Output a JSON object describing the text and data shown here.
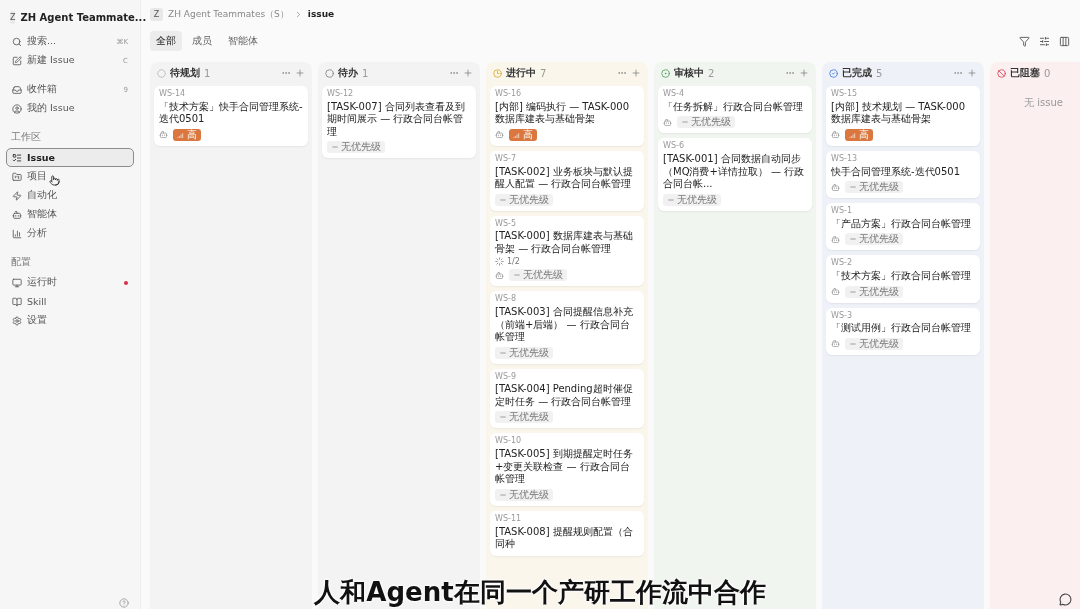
{
  "sidebar": {
    "workspace": {
      "initial": "Z",
      "name": "ZH Agent Teammate..."
    },
    "actions": [
      {
        "kind": "search",
        "label": "搜索...",
        "shortcut": "⌘K"
      },
      {
        "kind": "new",
        "label": "新建 Issue",
        "shortcut": "C"
      }
    ],
    "personal": [
      {
        "kind": "inbox",
        "label": "收件箱",
        "count": "9",
        "selected": false,
        "alert": false
      },
      {
        "kind": "mine",
        "label": "我的 Issue",
        "selected": false,
        "alert": false
      }
    ],
    "sections": [
      {
        "title": "工作区",
        "items": [
          {
            "kind": "issue",
            "label": "Issue",
            "selected": true,
            "alert": false
          },
          {
            "kind": "project",
            "label": "项目",
            "selected": false,
            "alert": false
          },
          {
            "kind": "automation",
            "label": "自动化",
            "selected": false,
            "alert": false
          },
          {
            "kind": "agent",
            "label": "智能体",
            "selected": false,
            "alert": false
          },
          {
            "kind": "analytics",
            "label": "分析",
            "selected": false,
            "alert": false
          }
        ]
      },
      {
        "title": "配置",
        "items": [
          {
            "kind": "runtime",
            "label": "运行时",
            "selected": false,
            "alert": true
          },
          {
            "kind": "skill",
            "label": "Skill",
            "selected": false,
            "alert": false
          },
          {
            "kind": "settings",
            "label": "设置",
            "selected": false,
            "alert": false
          }
        ]
      }
    ]
  },
  "breadcrumb": {
    "initial": "Z",
    "workspace": "ZH Agent Teammates（S）",
    "page": "issue"
  },
  "tabs": [
    {
      "label": "全部",
      "selected": true
    },
    {
      "label": "成员",
      "selected": false
    },
    {
      "label": "智能体",
      "selected": false
    }
  ],
  "columns": [
    {
      "kind": "planned",
      "title": "待规划",
      "count": "1",
      "cards": [
        {
          "id": "WS-14",
          "title": "「技术方案」快手合同管理系统-迭代0501",
          "agent": true,
          "priority": {
            "kind": "high",
            "label": "高"
          }
        }
      ]
    },
    {
      "kind": "todo",
      "title": "待办",
      "count": "1",
      "cards": [
        {
          "id": "WS-12",
          "title": "[TASK-007] 合同列表查看及到期时间展示 — 行政合同台帐管理",
          "agent": false,
          "priority": {
            "kind": "none",
            "label": "无优先级"
          }
        }
      ]
    },
    {
      "kind": "progress",
      "title": "进行中",
      "count": "7",
      "cards": [
        {
          "id": "WS-16",
          "title": "[内部] 编码执行 — TASK-000 数据库建表与基础骨架",
          "agent": true,
          "priority": {
            "kind": "high",
            "label": "高"
          }
        },
        {
          "id": "WS-7",
          "title": "[TASK-002] 业务板块与默认提醒人配置 — 行政合同台帐管理",
          "agent": false,
          "priority": {
            "kind": "none",
            "label": "无优先级"
          }
        },
        {
          "id": "WS-5",
          "title": "[TASK-000] 数据库建表与基础骨架 — 行政合同台帐管理",
          "progress": "1/2",
          "agent": true,
          "priority": {
            "kind": "none",
            "label": "无优先级"
          }
        },
        {
          "id": "WS-8",
          "title": "[TASK-003] 合同提醒信息补充（前端+后端） — 行政合同台帐管理",
          "agent": false,
          "priority": {
            "kind": "none",
            "label": "无优先级"
          }
        },
        {
          "id": "WS-9",
          "title": "[TASK-004] Pending超时催促定时任务 — 行政合同台帐管理",
          "agent": false,
          "priority": {
            "kind": "none",
            "label": "无优先级"
          }
        },
        {
          "id": "WS-10",
          "title": "[TASK-005] 到期提醒定时任务+变更关联检查 — 行政合同台帐管理",
          "agent": false,
          "priority": {
            "kind": "none",
            "label": "无优先级"
          }
        },
        {
          "id": "WS-11",
          "title": "[TASK-008] 提醒规则配置（合同种",
          "agent": false
        }
      ]
    },
    {
      "kind": "review",
      "title": "审核中",
      "count": "2",
      "cards": [
        {
          "id": "WS-4",
          "title": "「任务拆解」行政合同台帐管理",
          "agent": true,
          "priority": {
            "kind": "none",
            "label": "无优先级"
          }
        },
        {
          "id": "WS-6",
          "title": "[TASK-001] 合同数据自动同步（MQ消费+详情拉取） — 行政合同台帐...",
          "agent": false,
          "priority": {
            "kind": "none",
            "label": "无优先级"
          }
        }
      ]
    },
    {
      "kind": "done",
      "title": "已完成",
      "count": "5",
      "cards": [
        {
          "id": "WS-15",
          "title": "[内部] 技术规划 — TASK-000 数据库建表与基础骨架",
          "agent": true,
          "priority": {
            "kind": "high",
            "label": "高"
          }
        },
        {
          "id": "WS-13",
          "title": "快手合同管理系统-迭代0501",
          "agent": true,
          "priority": {
            "kind": "none",
            "label": "无优先级"
          }
        },
        {
          "id": "WS-1",
          "title": "「产品方案」行政合同台帐管理",
          "agent": true,
          "priority": {
            "kind": "none",
            "label": "无优先级"
          }
        },
        {
          "id": "WS-2",
          "title": "「技术方案」行政合同台帐管理",
          "agent": true,
          "priority": {
            "kind": "none",
            "label": "无优先级"
          }
        },
        {
          "id": "WS-3",
          "title": "「测试用例」行政合同台帐管理",
          "agent": true,
          "priority": {
            "kind": "none",
            "label": "无优先级"
          }
        }
      ]
    },
    {
      "kind": "blocked",
      "title": "已阻塞",
      "count": "0",
      "empty": "无 issue"
    }
  ],
  "subtitle": "人和Agent在同一个产研工作流中合作"
}
